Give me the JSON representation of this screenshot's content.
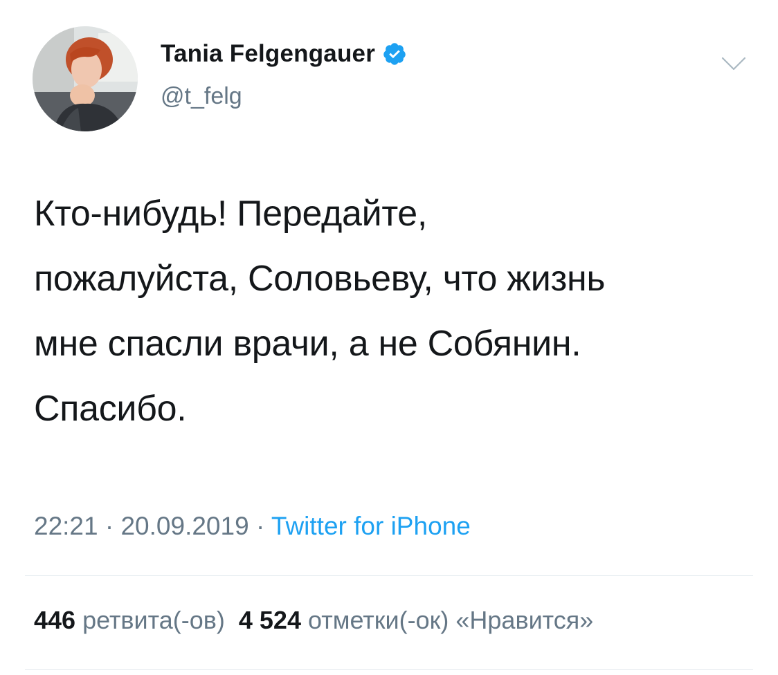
{
  "author": {
    "name": "Tania Felgengauer",
    "handle": "@t_felg",
    "verified": true
  },
  "tweet": {
    "lines": [
      "Кто-нибудь! Передайте,",
      "пожалуйста, Соловьеву, что жизнь",
      "мне спасли врачи, а не Собянин.",
      "Спасибо."
    ]
  },
  "meta": {
    "time": "22:21",
    "separator1": " · ",
    "date": "20.09.2019",
    "separator2": " · ",
    "source": "Twitter for iPhone"
  },
  "stats": {
    "retweets_count": "446",
    "retweets_label": "ретвита(-ов)",
    "likes_count": "4 524",
    "likes_label": "отметки(-ок) «Нравится»"
  },
  "colors": {
    "text": "#14171a",
    "secondary": "#657786",
    "accent": "#1da1f2",
    "divider": "#e1e8ed"
  }
}
